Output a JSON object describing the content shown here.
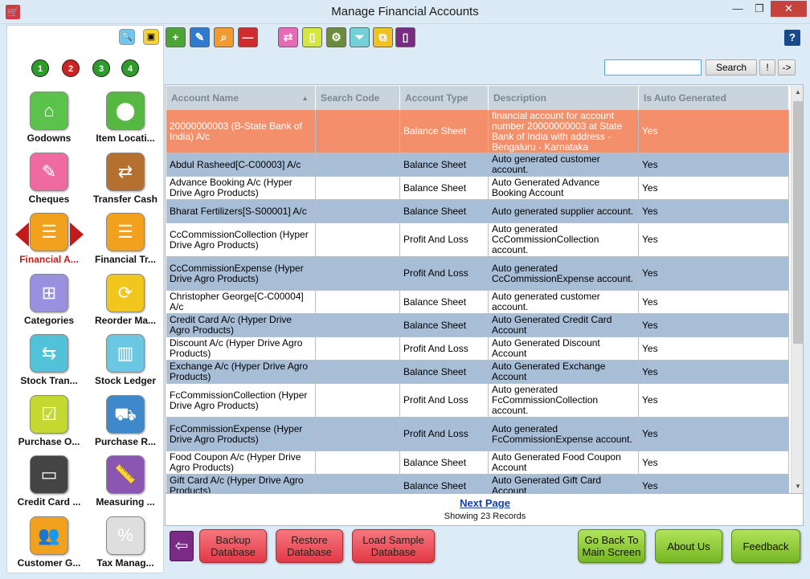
{
  "window": {
    "title": "Manage Financial Accounts",
    "min": "—",
    "max": "❐",
    "close": "✕",
    "app_icon": "🛒"
  },
  "sidebar": {
    "top_icons": [
      {
        "name": "search-icon",
        "glyph": "🔍"
      },
      {
        "name": "chat-icon",
        "glyph": "▣"
      }
    ],
    "pages": [
      "1",
      "2",
      "3",
      "4"
    ],
    "tiles": [
      {
        "label": "Godowns",
        "glyph": "⌂",
        "color": "#5bc24b"
      },
      {
        "label": "Item Locati...",
        "glyph": "⬤",
        "color": "#55b840"
      },
      {
        "label": "Cheques",
        "glyph": "✎",
        "color": "#ef6aa0"
      },
      {
        "label": "Transfer Cash",
        "glyph": "⇄",
        "color": "#b5702f"
      },
      {
        "label": "Financial A...",
        "glyph": "☰",
        "color": "#f1a11d"
      },
      {
        "label": "Financial Tr...",
        "glyph": "☰",
        "color": "#f1a11d"
      },
      {
        "label": "Categories",
        "glyph": "⊞",
        "color": "#9a90e0"
      },
      {
        "label": "Reorder Ma...",
        "glyph": "⟳",
        "color": "#f1c71d"
      },
      {
        "label": "Stock Tran...",
        "glyph": "⇆",
        "color": "#52c2d8"
      },
      {
        "label": "Stock Ledger",
        "glyph": "▥",
        "color": "#6bc8e3"
      },
      {
        "label": "Purchase O...",
        "glyph": "☑",
        "color": "#c3d930"
      },
      {
        "label": "Purchase R...",
        "glyph": "⛟",
        "color": "#3f88c9"
      },
      {
        "label": "Credit Card ...",
        "glyph": "▭",
        "color": "#444444"
      },
      {
        "label": "Measuring ...",
        "glyph": "📏",
        "color": "#8b55b2"
      },
      {
        "label": "Customer G...",
        "glyph": "👥",
        "color": "#f1a11d"
      },
      {
        "label": "Tax Manag...",
        "glyph": "%",
        "color": "#dedede"
      }
    ]
  },
  "toolbar": {
    "buttons": [
      {
        "name": "add-icon",
        "glyph": "+",
        "color": "#4aa532"
      },
      {
        "name": "edit-icon",
        "glyph": "✎",
        "color": "#2c7bd1"
      },
      {
        "name": "find-icon",
        "glyph": "⌕",
        "color": "#f19a2e"
      },
      {
        "name": "delete-icon",
        "glyph": "—",
        "color": "#d12b2b"
      },
      {
        "name": "swap-icon",
        "glyph": "⇄",
        "color": "#e968b8"
      },
      {
        "name": "new-doc-icon",
        "glyph": "▯",
        "color": "#d3e83b"
      },
      {
        "name": "settings-icon",
        "glyph": "⚙",
        "color": "#6b8d3b"
      },
      {
        "name": "filter-icon",
        "glyph": "⏷",
        "color": "#71d1d6"
      },
      {
        "name": "copy-icon",
        "glyph": "⧉",
        "color": "#f1c21d"
      },
      {
        "name": "document-icon",
        "glyph": "▯",
        "color": "#7b2a85"
      }
    ],
    "help": "?"
  },
  "search": {
    "value": "",
    "button": "Search",
    "bang": "!",
    "next": "->"
  },
  "grid": {
    "headers": [
      "Account Name",
      "Search Code",
      "Account Type",
      "Description",
      "Is Auto Generated"
    ],
    "rows": [
      [
        "20000000003 (B-State Bank of India) A/c",
        "",
        "Balance Sheet",
        "financial account for account number 20000000003 at State Bank of India with address - Bengaluru - Karnataka",
        "Yes"
      ],
      [
        "Abdul Rasheed[C-C00003] A/c",
        "",
        "Balance Sheet",
        "Auto generated customer account.",
        "Yes"
      ],
      [
        "Advance Booking A/c (Hyper Drive Agro Products)",
        "",
        "Balance Sheet",
        "Auto Generated Advance Booking Account",
        "Yes"
      ],
      [
        "Bharat Fertilizers[S-S00001] A/c",
        "",
        "Balance Sheet",
        "Auto generated supplier account.",
        "Yes"
      ],
      [
        "CcCommissionCollection (Hyper Drive Agro Products)",
        "",
        "Profit And Loss",
        "Auto generated CcCommissionCollection account.",
        "Yes"
      ],
      [
        "CcCommissionExpense (Hyper Drive Agro Products)",
        "",
        "Profit And Loss",
        "Auto generated CcCommissionExpense account.",
        "Yes"
      ],
      [
        "Christopher George[C-C00004] A/c",
        "",
        "Balance Sheet",
        "Auto generated customer account.",
        "Yes"
      ],
      [
        "Credit Card A/c (Hyper Drive Agro Products)",
        "",
        "Balance Sheet",
        "Auto Generated Credit Card Account",
        "Yes"
      ],
      [
        "Discount A/c (Hyper Drive Agro Products)",
        "",
        "Profit And Loss",
        "Auto Generated Discount Account",
        "Yes"
      ],
      [
        "Exchange A/c (Hyper Drive Agro Products)",
        "",
        "Balance Sheet",
        "Auto Generated Exchange Account",
        "Yes"
      ],
      [
        "FcCommissionCollection (Hyper Drive Agro Products)",
        "",
        "Profit And Loss",
        "Auto generated FcCommissionCollection account.",
        "Yes"
      ],
      [
        "FcCommissionExpense (Hyper Drive Agro Products)",
        "",
        "Profit And Loss",
        "Auto generated FcCommissionExpense account.",
        "Yes"
      ],
      [
        "Food Coupon A/c (Hyper Drive Agro Products)",
        "",
        "Balance Sheet",
        "Auto Generated Food Coupon Account",
        "Yes"
      ],
      [
        "Gift Card A/c (Hyper Drive Agro Products)",
        "",
        "Balance Sheet",
        "Auto Generated Gift Card Account",
        "Yes"
      ]
    ]
  },
  "pager": {
    "next": "Next Page",
    "records": "Showing 23 Records"
  },
  "bottom": {
    "back_glyph": "⇦",
    "backup": "Backup Database",
    "restore": "Restore Database",
    "load_sample": "Load Sample Database",
    "go_back": "Go Back To Main Screen",
    "about": "About Us",
    "feedback": "Feedback"
  }
}
